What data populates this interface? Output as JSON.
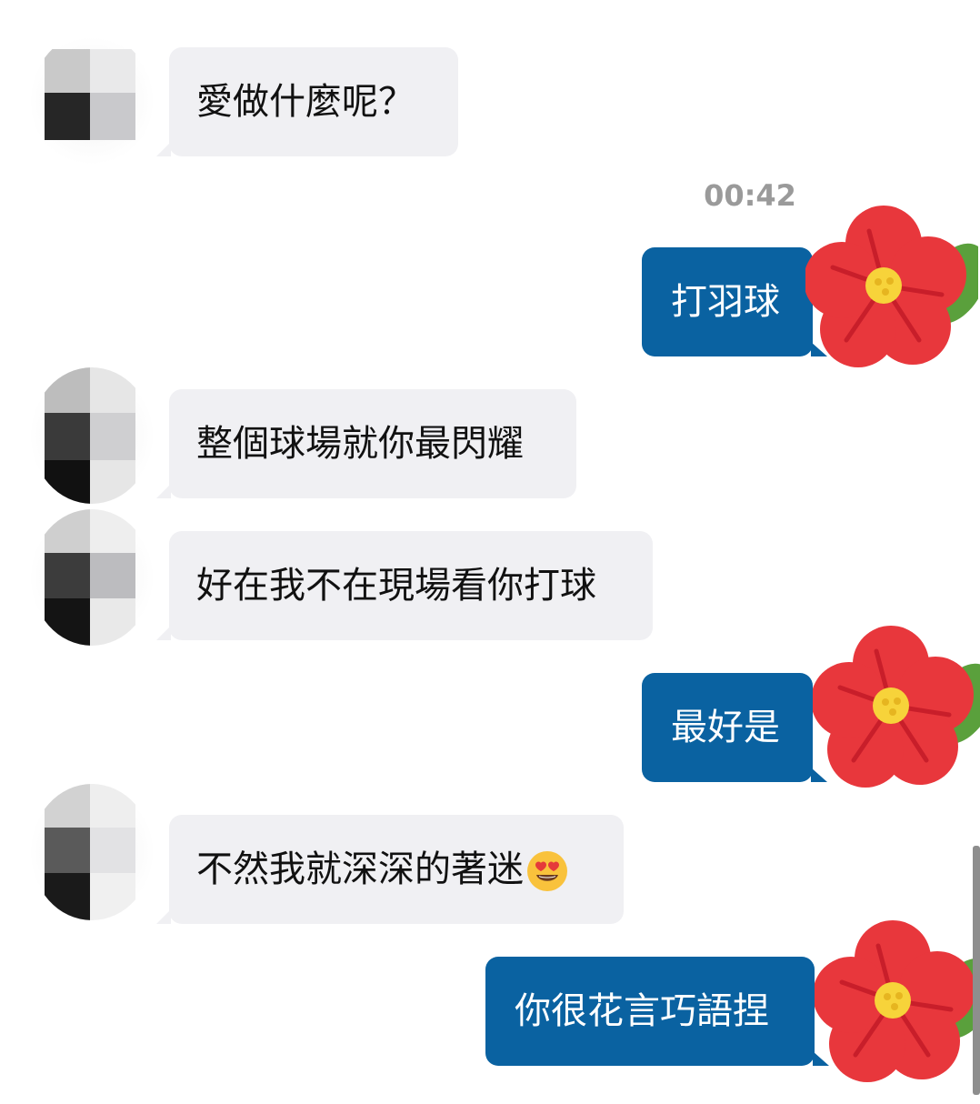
{
  "messages": [
    {
      "side": "in",
      "text": "愛做什麼呢？"
    },
    {
      "side": "out",
      "text": "打羽球",
      "time": "00:42"
    },
    {
      "side": "in",
      "text": "整個球場就你最閃耀"
    },
    {
      "side": "in",
      "text": "好在我不在現場看你打球"
    },
    {
      "side": "out",
      "text": "最好是"
    },
    {
      "side": "in",
      "text": "不然我就深深的著迷",
      "emoji": "heart-eyes-emoji"
    },
    {
      "side": "out",
      "text": "你很花言巧語捏"
    }
  ],
  "colors": {
    "incoming_bubble": "#f0f0f3",
    "outgoing_bubble": "#0a62a1",
    "timestamp": "#9a9a9a",
    "flower_petal": "#e8373c",
    "flower_center": "#f7d33a",
    "leaf": "#5aa03c"
  }
}
